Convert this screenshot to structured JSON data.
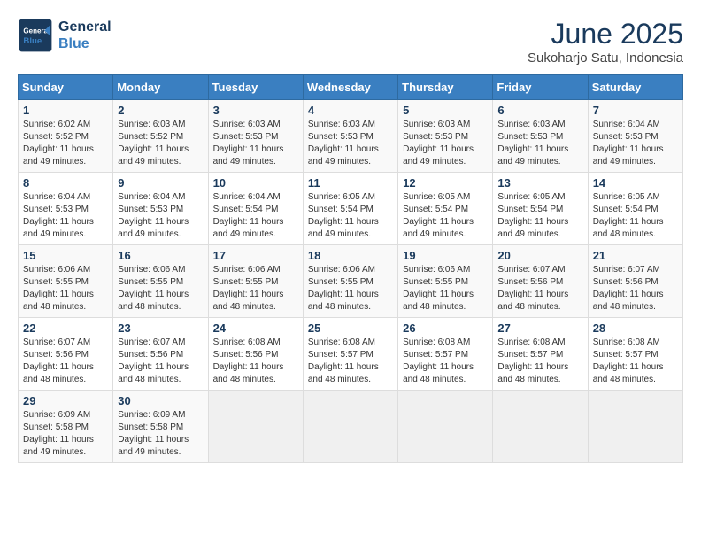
{
  "logo": {
    "line1": "General",
    "line2": "Blue"
  },
  "title": "June 2025",
  "subtitle": "Sukoharjo Satu, Indonesia",
  "weekdays": [
    "Sunday",
    "Monday",
    "Tuesday",
    "Wednesday",
    "Thursday",
    "Friday",
    "Saturday"
  ],
  "weeks": [
    [
      {
        "day": "1",
        "rise": "6:02 AM",
        "set": "5:52 PM",
        "daylight": "11 hours and 49 minutes."
      },
      {
        "day": "2",
        "rise": "6:03 AM",
        "set": "5:52 PM",
        "daylight": "11 hours and 49 minutes."
      },
      {
        "day": "3",
        "rise": "6:03 AM",
        "set": "5:53 PM",
        "daylight": "11 hours and 49 minutes."
      },
      {
        "day": "4",
        "rise": "6:03 AM",
        "set": "5:53 PM",
        "daylight": "11 hours and 49 minutes."
      },
      {
        "day": "5",
        "rise": "6:03 AM",
        "set": "5:53 PM",
        "daylight": "11 hours and 49 minutes."
      },
      {
        "day": "6",
        "rise": "6:03 AM",
        "set": "5:53 PM",
        "daylight": "11 hours and 49 minutes."
      },
      {
        "day": "7",
        "rise": "6:04 AM",
        "set": "5:53 PM",
        "daylight": "11 hours and 49 minutes."
      }
    ],
    [
      {
        "day": "8",
        "rise": "6:04 AM",
        "set": "5:53 PM",
        "daylight": "11 hours and 49 minutes."
      },
      {
        "day": "9",
        "rise": "6:04 AM",
        "set": "5:53 PM",
        "daylight": "11 hours and 49 minutes."
      },
      {
        "day": "10",
        "rise": "6:04 AM",
        "set": "5:54 PM",
        "daylight": "11 hours and 49 minutes."
      },
      {
        "day": "11",
        "rise": "6:05 AM",
        "set": "5:54 PM",
        "daylight": "11 hours and 49 minutes."
      },
      {
        "day": "12",
        "rise": "6:05 AM",
        "set": "5:54 PM",
        "daylight": "11 hours and 49 minutes."
      },
      {
        "day": "13",
        "rise": "6:05 AM",
        "set": "5:54 PM",
        "daylight": "11 hours and 49 minutes."
      },
      {
        "day": "14",
        "rise": "6:05 AM",
        "set": "5:54 PM",
        "daylight": "11 hours and 48 minutes."
      }
    ],
    [
      {
        "day": "15",
        "rise": "6:06 AM",
        "set": "5:55 PM",
        "daylight": "11 hours and 48 minutes."
      },
      {
        "day": "16",
        "rise": "6:06 AM",
        "set": "5:55 PM",
        "daylight": "11 hours and 48 minutes."
      },
      {
        "day": "17",
        "rise": "6:06 AM",
        "set": "5:55 PM",
        "daylight": "11 hours and 48 minutes."
      },
      {
        "day": "18",
        "rise": "6:06 AM",
        "set": "5:55 PM",
        "daylight": "11 hours and 48 minutes."
      },
      {
        "day": "19",
        "rise": "6:06 AM",
        "set": "5:55 PM",
        "daylight": "11 hours and 48 minutes."
      },
      {
        "day": "20",
        "rise": "6:07 AM",
        "set": "5:56 PM",
        "daylight": "11 hours and 48 minutes."
      },
      {
        "day": "21",
        "rise": "6:07 AM",
        "set": "5:56 PM",
        "daylight": "11 hours and 48 minutes."
      }
    ],
    [
      {
        "day": "22",
        "rise": "6:07 AM",
        "set": "5:56 PM",
        "daylight": "11 hours and 48 minutes."
      },
      {
        "day": "23",
        "rise": "6:07 AM",
        "set": "5:56 PM",
        "daylight": "11 hours and 48 minutes."
      },
      {
        "day": "24",
        "rise": "6:08 AM",
        "set": "5:56 PM",
        "daylight": "11 hours and 48 minutes."
      },
      {
        "day": "25",
        "rise": "6:08 AM",
        "set": "5:57 PM",
        "daylight": "11 hours and 48 minutes."
      },
      {
        "day": "26",
        "rise": "6:08 AM",
        "set": "5:57 PM",
        "daylight": "11 hours and 48 minutes."
      },
      {
        "day": "27",
        "rise": "6:08 AM",
        "set": "5:57 PM",
        "daylight": "11 hours and 48 minutes."
      },
      {
        "day": "28",
        "rise": "6:08 AM",
        "set": "5:57 PM",
        "daylight": "11 hours and 48 minutes."
      }
    ],
    [
      {
        "day": "29",
        "rise": "6:09 AM",
        "set": "5:58 PM",
        "daylight": "11 hours and 49 minutes."
      },
      {
        "day": "30",
        "rise": "6:09 AM",
        "set": "5:58 PM",
        "daylight": "11 hours and 49 minutes."
      },
      null,
      null,
      null,
      null,
      null
    ]
  ],
  "labels": {
    "sunrise": "Sunrise:",
    "sunset": "Sunset:",
    "daylight": "Daylight:"
  }
}
